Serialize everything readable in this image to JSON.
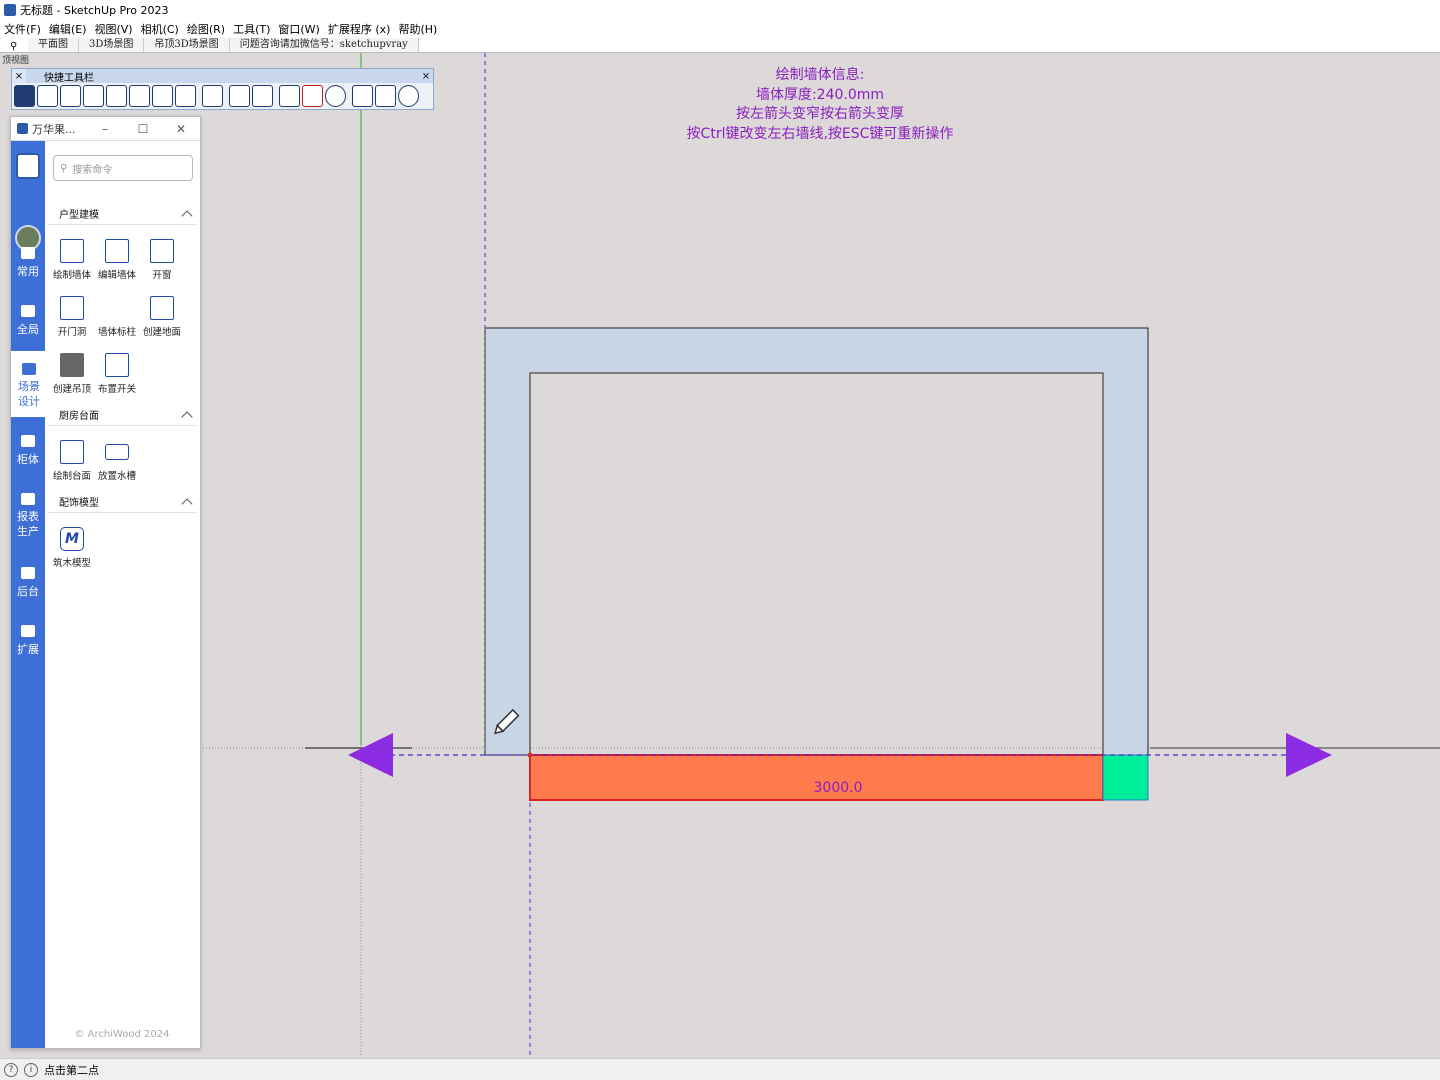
{
  "window": {
    "title": "无标题 - SketchUp Pro 2023"
  },
  "menu": [
    "文件(F)",
    "编辑(E)",
    "视图(V)",
    "相机(C)",
    "绘图(R)",
    "工具(T)",
    "窗口(W)",
    "扩展程序 (x)",
    "帮助(H)"
  ],
  "scenes": [
    "平面图",
    "3D场景图",
    "吊顶3D场景图",
    "问题咨询请加微信号：sketchupvray"
  ],
  "view_label": "顶视图",
  "quick_toolbar": {
    "title": "快捷工具栏",
    "close": "×"
  },
  "panel": {
    "title": "万华果...",
    "controls": [
      "–",
      "☐",
      "✕"
    ],
    "search_placeholder": "搜索命令",
    "rail": [
      "常用",
      "全局",
      "场景设计",
      "柜体",
      "报表生产",
      "后台",
      "扩展"
    ],
    "active_rail": "场景设计",
    "sections": [
      {
        "title": "户型建模",
        "tools": [
          "绘制墙体",
          "编辑墙体",
          "开窗",
          "开门洞",
          "墙体标柱",
          "创建地面",
          "创建吊顶",
          "布置开关"
        ]
      },
      {
        "title": "厨房台面",
        "tools": [
          "绘制台面",
          "放置水槽"
        ]
      },
      {
        "title": "配饰模型",
        "tools": [
          "筑木模型"
        ]
      }
    ],
    "brand_icon": "M",
    "copyright": "© ArchiWood 2024"
  },
  "wall_info": {
    "line1": "绘制墙体信息:",
    "line2": "墙体厚度:240.0mm",
    "line3": "按左箭头变窄按右箭头变厚",
    "line4": "按Ctrl键改变左右墙线,按ESC键可重新操作"
  },
  "dimension": "3000.0",
  "status": {
    "text": "点击第二点"
  },
  "colors": {
    "wall": "#c9d5e4",
    "new_wall": "#ff7b4e",
    "corner": "#00ee99",
    "arrow": "#8b2be2",
    "info_text": "#8a1ec0",
    "panel_rail": "#3d6fd6",
    "green_axis": "#2db52d"
  }
}
